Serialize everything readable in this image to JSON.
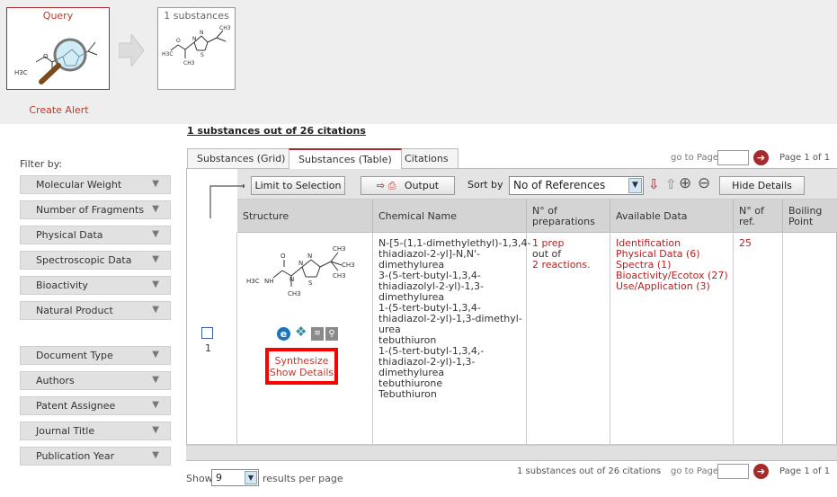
{
  "query_panel": {
    "query_label": "Query",
    "result_label": "1 substances",
    "create_alert": "Create Alert"
  },
  "filters": {
    "title": "Filter by:",
    "group1": [
      "Molecular Weight",
      "Number of Fragments",
      "Physical Data",
      "Spectroscopic Data",
      "Bioactivity",
      "Natural Product"
    ],
    "group2": [
      "Document Type",
      "Authors",
      "Patent Assignee",
      "Journal Title",
      "Publication Year"
    ]
  },
  "summary": "1 substances out of 26 citations",
  "tabs": [
    "Substances (Grid)",
    "Substances (Table)",
    "Citations"
  ],
  "pagination": {
    "goto_label": "go to Page",
    "page_of": "Page 1 of 1"
  },
  "toolbar": {
    "limit_label": "Limit to Selection",
    "output_label": "Output",
    "sortby_label": "Sort by",
    "sort_value": "No of References",
    "hide_details": "Hide Details"
  },
  "table": {
    "headers": [
      "Structure",
      "Chemical Name",
      "N° of preparations",
      "Available Data",
      "N° of ref.",
      "Boiling Point"
    ],
    "row": {
      "index": "1",
      "chemical_names": [
        "N-[5-(1,1-dimethylethyl)-1,3,4-",
        "thiadiazol-2-yl]-N,N'-",
        "dimethylurea",
        "3-(5-tert-butyl-1,3,4-",
        "thiadiazolyl-2-yl)-1,3-",
        "dimethylurea",
        "1-(5-tert-butyl-1,3,4-",
        "thiadiazol-2-yl)-1,3-dimethyl-",
        "urea",
        "tebuthiuron",
        "1-(5-tert-butyl-1,3,4,-",
        "thiadiazol-2-yl)-1,3-",
        "dimethylurea",
        "tebuthiurone",
        "Tebuthiuron"
      ],
      "preparations": [
        "1 prep",
        "out of",
        "2 reactions."
      ],
      "available_data": [
        "Identification",
        "Physical Data (6)",
        "Spectra (1)",
        "Bioactivity/Ecotox (27)",
        "Use/Application (3)"
      ],
      "n_refs": "25",
      "synthesize": "Synthesize",
      "show_details": "Show Details"
    }
  },
  "footer": {
    "show_label": "Show",
    "rpp_value": "9",
    "rpp_label": "results per page",
    "summary": "1 substances out of 26 citations"
  },
  "colors": {
    "accent": "#a52a2a",
    "link": "#b22222",
    "highlight": "#ff0000"
  }
}
